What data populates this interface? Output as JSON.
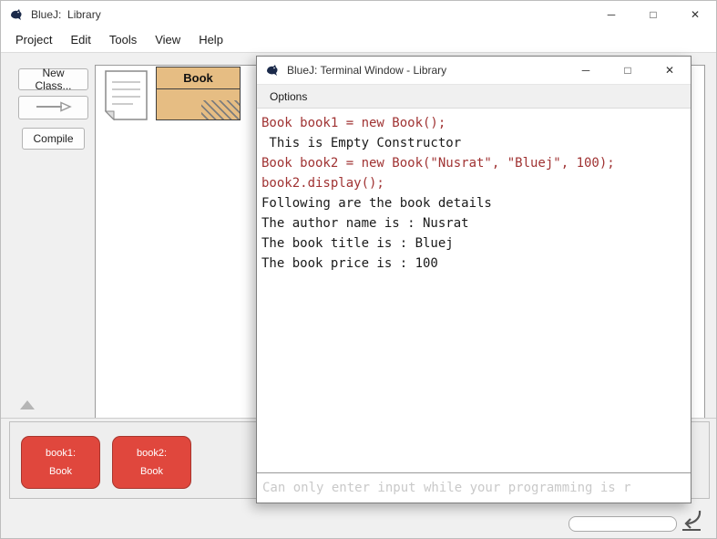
{
  "main_window": {
    "title": "BlueJ:  Library",
    "menus": [
      "Project",
      "Edit",
      "Tools",
      "View",
      "Help"
    ],
    "sidebar": {
      "new_class_label": "New Class...",
      "compile_label": "Compile"
    },
    "class_diagram": {
      "book_class_label": "Book"
    },
    "object_bench": {
      "objects": [
        {
          "name": "book1:",
          "type": "Book"
        },
        {
          "name": "book2:",
          "type": "Book"
        }
      ]
    }
  },
  "terminal_window": {
    "title": "BlueJ: Terminal Window - Library",
    "menu_label": "Options",
    "lines": [
      {
        "text": "Book book1 = new Book();",
        "color": "red"
      },
      {
        "text": " This is Empty Constructor",
        "color": "black"
      },
      {
        "text": "Book book2 = new Book(\"Nusrat\", \"Bluej\", 100);",
        "color": "red"
      },
      {
        "text": "book2.display();",
        "color": "red"
      },
      {
        "text": "Following are the book details",
        "color": "black"
      },
      {
        "text": "The author name is : Nusrat",
        "color": "black"
      },
      {
        "text": "The book title is : Bluej",
        "color": "black"
      },
      {
        "text": "The book price is : 100",
        "color": "black"
      }
    ],
    "input_hint": "Can only enter input while your programming is r"
  },
  "icons": {
    "minimize": "─",
    "maximize": "□",
    "close": "✕"
  },
  "colors": {
    "terminal_red": "#a03333",
    "terminal_text": "#1a1a1a",
    "object_red": "#e0473d",
    "class_fill": "#e6bd83"
  }
}
